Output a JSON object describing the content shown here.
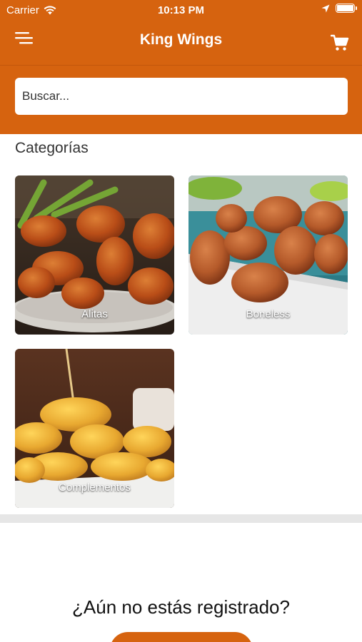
{
  "status_bar": {
    "carrier": "Carrier",
    "time": "10:13 PM"
  },
  "navbar": {
    "title": "King Wings",
    "left_icon": "menu-icon",
    "right_icon": "cart-icon"
  },
  "search": {
    "placeholder": "Buscar..."
  },
  "categories_section": {
    "title": "Categorías",
    "items": [
      {
        "label": "Alitas"
      },
      {
        "label": "Boneless"
      },
      {
        "label": "Complementos"
      }
    ]
  },
  "register": {
    "question": "¿Aún no estás registrado?"
  },
  "colors": {
    "brand": "#d6630f",
    "background": "#ffffff",
    "band": "#e6e6e6"
  }
}
